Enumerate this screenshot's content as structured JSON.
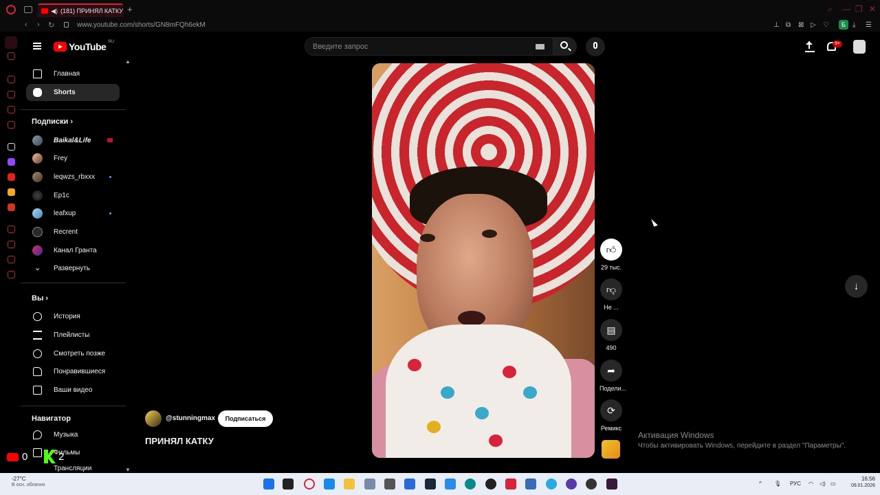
{
  "browser": {
    "tab_title": "(181) ПРИНЯЛ КАТКУ",
    "new_tab": "+",
    "url": "www.youtube.com/shorts/GN8mFQh6ekM",
    "profile_letter": "Б"
  },
  "header": {
    "logo_text": "YouTube",
    "logo_region": "RU",
    "search_placeholder": "Введите запрос",
    "notifications_badge": "9+"
  },
  "sidebar": {
    "main": [
      {
        "label": "Главная",
        "icon": "home-icon"
      },
      {
        "label": "Shorts",
        "icon": "shorts-icon"
      }
    ],
    "subscriptions_title": "Подписки",
    "subscriptions": [
      {
        "label": "Baikal&Life",
        "badge": "live"
      },
      {
        "label": "Frey",
        "badge": ""
      },
      {
        "label": "leqwzs_rbxxx",
        "badge": "dot"
      },
      {
        "label": "Ep1c",
        "badge": ""
      },
      {
        "label": "leafxup",
        "badge": "dot"
      },
      {
        "label": "Recrent",
        "badge": ""
      },
      {
        "label": "Канал Гранта",
        "badge": ""
      }
    ],
    "expand_label": "Развернуть",
    "you_title": "Вы",
    "you_items": [
      {
        "label": "История",
        "icon": "history-icon"
      },
      {
        "label": "Плейлисты",
        "icon": "playlists-icon"
      },
      {
        "label": "Смотреть позже",
        "icon": "watch-later-icon"
      },
      {
        "label": "Понравившиеся",
        "icon": "thumb-up-icon"
      },
      {
        "label": "Ваши видео",
        "icon": "your-videos-icon"
      }
    ],
    "navigator_title": "Навигатор",
    "navigator_items": [
      {
        "label": "Музыка",
        "icon": "music-icon"
      },
      {
        "label": "Фильмы",
        "icon": "films-icon"
      },
      {
        "label": "Трансляции",
        "icon": "live-icon"
      }
    ]
  },
  "short": {
    "channel": "@stunningmax",
    "subscribe_label": "Подписаться",
    "title": "ПРИНЯЛ КАТКУ",
    "actions": {
      "like_count": "29 тыс.",
      "dislike_label": "Не ...",
      "comments_count": "490",
      "share_label": "Подели...",
      "remix_label": "Ремикс"
    }
  },
  "windows_activation": {
    "title": "Активация Windows",
    "subtitle": "Чтобы активировать Windows, перейдите в раздел \"Параметры\"."
  },
  "stream_overlay": {
    "youtube_count": "0",
    "kick_count": "2"
  },
  "taskbar": {
    "weather_temp": "-27°C",
    "weather_desc": "В осн. облачно",
    "language": "РУС",
    "time": "16:56",
    "date": "09.01.2026"
  },
  "colors": {
    "accent_opera": "#d2263a",
    "youtube_red": "#ff0000",
    "background": "#000000",
    "active_nav": "#272727"
  }
}
